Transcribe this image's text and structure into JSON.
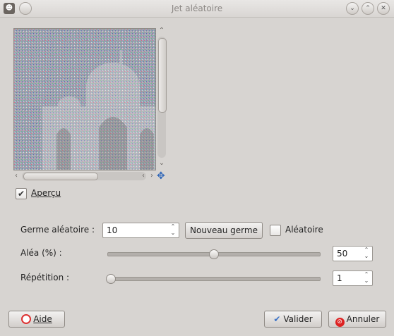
{
  "window": {
    "title": "Jet aléatoire",
    "app_icon_glyph": "☻",
    "controls": [
      "minimize",
      "maximize",
      "close"
    ]
  },
  "preview": {
    "checkbox_label": "Aperçu",
    "checked": true,
    "vscroll_position": 0.1,
    "hscroll_position": 0.1
  },
  "seed": {
    "label": "Germe aléatoire :",
    "value": "10",
    "new_seed_button": "Nouveau germe",
    "random_label": "Aléatoire",
    "random_checked": false
  },
  "randomization": {
    "label": "Aléa (%) :",
    "value": "50",
    "fraction": 0.5
  },
  "repeat": {
    "label": "Répétition :",
    "value": "1",
    "fraction": 0.0
  },
  "buttons": {
    "help": "Aide",
    "ok": "Valider",
    "cancel": "Annuler"
  },
  "colors": {
    "background": "#d7d4d1",
    "accent": "#3a72c7",
    "cancel_red": "#d22222"
  },
  "icons": {
    "help": "help-lifebuoy-icon",
    "ok": "checkmark-icon",
    "cancel": "cancel-icon",
    "navigate": "navigate-cross-icon"
  }
}
